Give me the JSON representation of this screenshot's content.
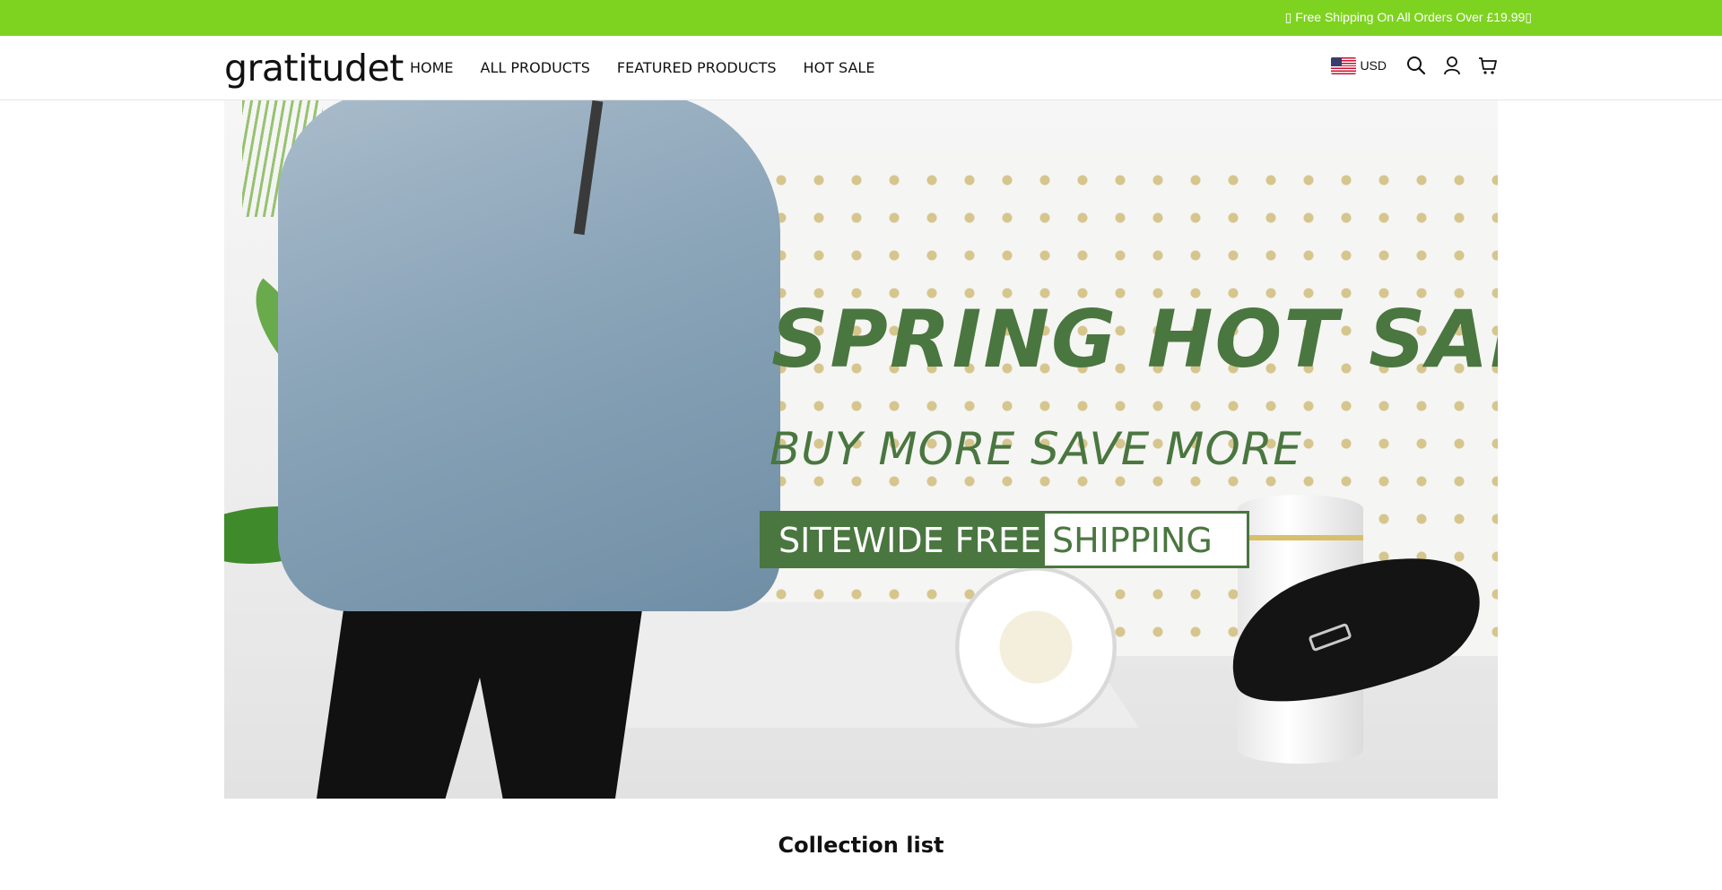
{
  "announcement": {
    "text": "▯ Free Shipping On All Orders Over £19.99▯"
  },
  "header": {
    "logo": "gratitudet",
    "nav": [
      {
        "label": "HOME"
      },
      {
        "label": "ALL PRODUCTS"
      },
      {
        "label": "FEATURED PRODUCTS"
      },
      {
        "label": "HOT SALE"
      }
    ],
    "currency": {
      "flag": "us-flag-icon",
      "label": "USD"
    },
    "icons": [
      "search-icon",
      "account-icon",
      "cart-icon"
    ]
  },
  "hero": {
    "title": "SPRING HOT SALE",
    "subtitle": "BUY MORE SAVE MORE",
    "badge_left": "SITEWIDE FREE",
    "badge_right": "SHIPPING"
  },
  "collection": {
    "title": "Collection list"
  },
  "colors": {
    "announcement_bg": "#7ed321",
    "hero_green": "#4a7640"
  }
}
